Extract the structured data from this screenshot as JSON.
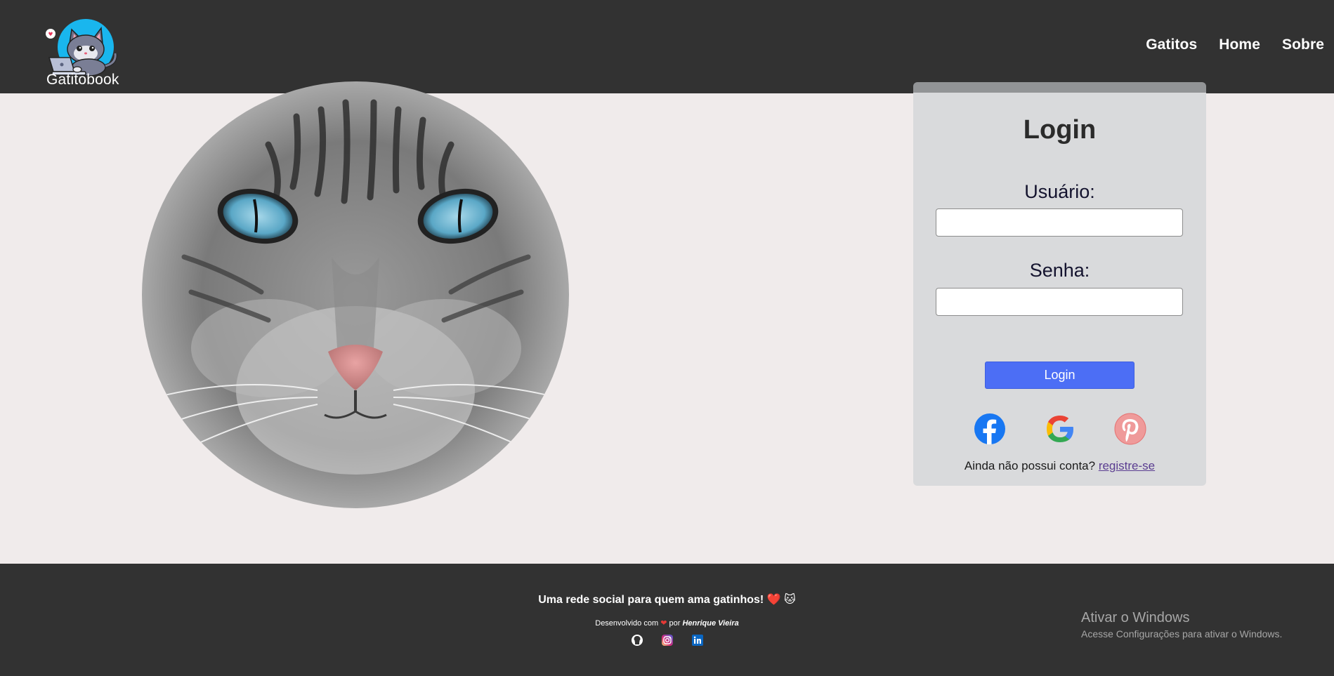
{
  "header": {
    "brand": "Gatitobook",
    "nav": [
      "Gatitos",
      "Home",
      "Sobre"
    ]
  },
  "login": {
    "title": "Login",
    "username_label": "Usuário:",
    "password_label": "Senha:",
    "username_value": "",
    "password_value": "",
    "submit_label": "Login",
    "social": [
      "facebook-icon",
      "google-icon",
      "pinterest-icon"
    ],
    "register_prompt": "Ainda não possui conta?",
    "register_link": "registre-se"
  },
  "footer": {
    "tagline": "Uma rede social para quem ama gatinhos!",
    "tagline_emoji": "❤️ 🐱",
    "dev_prefix": "Desenvolvido com",
    "dev_by": "por",
    "dev_author": "Henrique Vieira",
    "icons": [
      "github-icon",
      "instagram-icon",
      "linkedin-icon"
    ]
  },
  "windows_watermark": {
    "title": "Ativar o Windows",
    "subtitle": "Acesse Configurações para ativar o Windows."
  },
  "colors": {
    "header_bg": "#323232",
    "page_bg": "#f0ebeb",
    "card_bg": "#d9dadc",
    "button": "#4c6ef5"
  }
}
